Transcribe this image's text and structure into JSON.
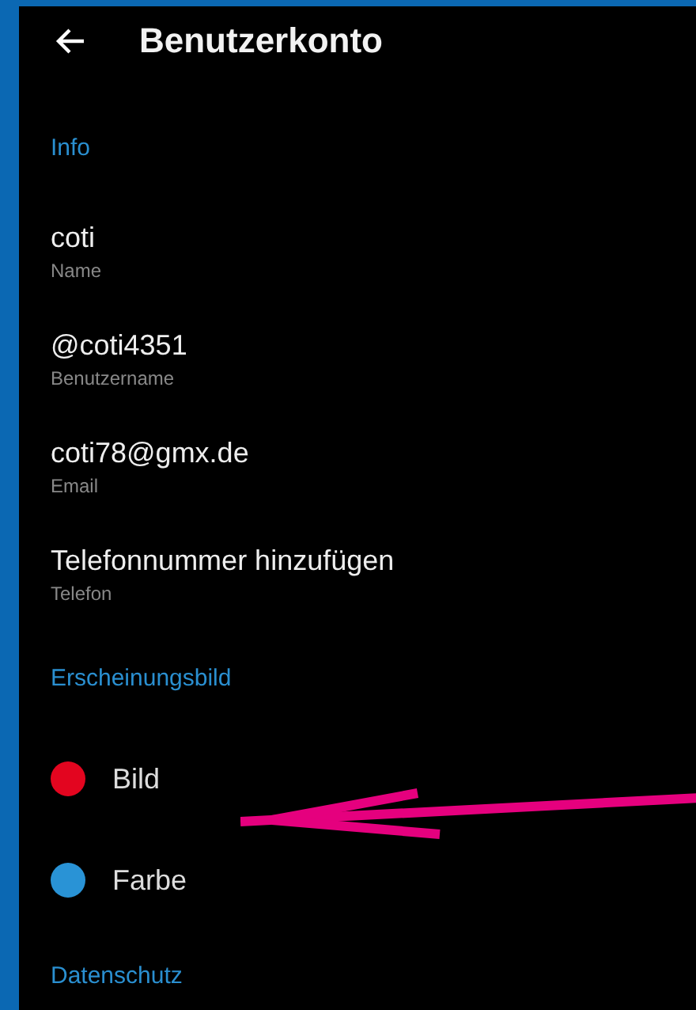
{
  "header": {
    "title": "Benutzerkonto"
  },
  "sections": [
    {
      "title": "Info",
      "items": [
        {
          "kind": "field",
          "value": "coti",
          "label": "Name"
        },
        {
          "kind": "field",
          "value": "@coti4351",
          "label": "Benutzername"
        },
        {
          "kind": "field",
          "value": "coti78@gmx.de",
          "label": "Email"
        },
        {
          "kind": "field",
          "value": "Telefonnummer hinzufügen",
          "label": "Telefon"
        }
      ]
    },
    {
      "title": "Erscheinungsbild",
      "items": [
        {
          "kind": "option",
          "label": "Bild",
          "color": "#e3051f"
        },
        {
          "kind": "option",
          "label": "Farbe",
          "color": "#2993d6"
        }
      ]
    },
    {
      "title": "Datenschutz"
    }
  ]
}
